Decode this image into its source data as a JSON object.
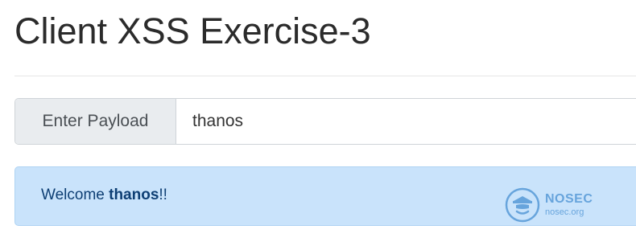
{
  "page": {
    "title": "Client XSS Exercise-3"
  },
  "form": {
    "addon_label": "Enter Payload",
    "payload_value": "thanos"
  },
  "alert": {
    "prefix": "Welcome ",
    "name": "thanos",
    "suffix": "!!"
  },
  "watermark": {
    "icon": "nosec-logo-icon",
    "brand": "NOSEC",
    "url": "nosec.org"
  },
  "colors": {
    "alert_background": "#c9e3fb",
    "alert_text": "#0e3f74",
    "addon_background": "#e9ecef"
  }
}
